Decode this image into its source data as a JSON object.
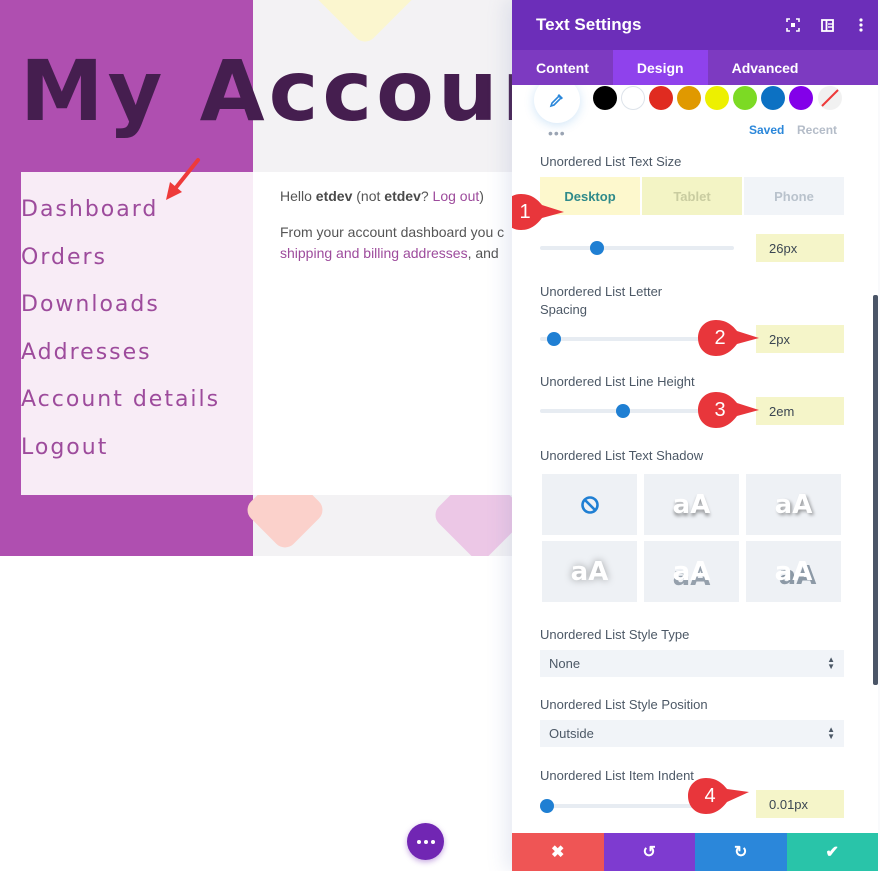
{
  "page": {
    "title": "My Account",
    "nav_items": [
      "Dashboard",
      "Orders",
      "Downloads",
      "Addresses",
      "Account details",
      "Logout"
    ],
    "content": {
      "hello_prefix": "Hello ",
      "username": "etdev",
      "not_prefix": " (not ",
      "not_user": "etdev",
      "not_suffix": "? ",
      "logout_link": "Log out",
      "close_paren": ")",
      "para_start": "From your account dashboard you c",
      "addresses_link": "shipping and billing addresses",
      "para_end": ", and"
    },
    "fab_icon": "more-dots-icon"
  },
  "panel": {
    "title": "Text Settings",
    "header_icons": [
      "fullscreen-icon",
      "split-view-icon",
      "more-vertical-icon"
    ],
    "tabs": [
      {
        "label": "Content",
        "active": false
      },
      {
        "label": "Design",
        "active": true
      },
      {
        "label": "Advanced",
        "active": false
      }
    ],
    "colors": {
      "swatches": [
        "#000000",
        "#ffffff",
        "#e02b20",
        "#e09900",
        "#edf000",
        "#7cda24",
        "#0c71c3",
        "#8300e9"
      ],
      "saved_label": "Saved",
      "recent_label": "Recent",
      "more_label": "•••"
    },
    "text_size": {
      "label": "Unordered List Text Size",
      "devices": [
        "Desktop",
        "Tablet",
        "Phone"
      ],
      "active_device": "Desktop",
      "value": "26px",
      "slider_fraction": 0.28
    },
    "letter_spacing": {
      "label_line1": "Unordered List Letter",
      "label_line2": "Spacing",
      "value": "2px",
      "slider_fraction": 0.05
    },
    "line_height": {
      "label": "Unordered List Line Height",
      "value": "2em",
      "slider_fraction": 0.52
    },
    "text_shadow": {
      "label": "Unordered List Text Shadow",
      "options": [
        "none",
        "aA",
        "aA",
        "aA",
        "aA",
        "aA"
      ],
      "selected": 0
    },
    "style_type": {
      "label": "Unordered List Style Type",
      "value": "None"
    },
    "style_position": {
      "label": "Unordered List Style Position",
      "value": "Outside"
    },
    "item_indent": {
      "label": "Unordered List Item Indent",
      "value": "0.01px",
      "slider_fraction": 0.0
    },
    "callouts": [
      "1",
      "2",
      "3",
      "4"
    ],
    "footer": {
      "cancel_icon": "close-icon",
      "undo_icon": "undo-icon",
      "redo_icon": "redo-icon",
      "save_icon": "check-icon",
      "cancel_glyph": "✖",
      "undo_glyph": "↺",
      "redo_glyph": "↻",
      "save_glyph": "✔"
    },
    "accent_color": "#6c2eb9"
  }
}
